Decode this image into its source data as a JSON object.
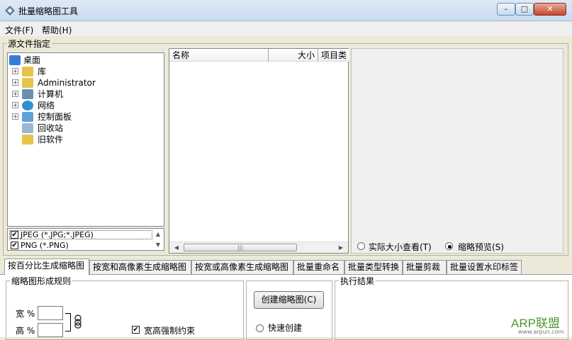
{
  "window": {
    "title": "批量缩略图工具",
    "min": "–",
    "max": "□",
    "close": "✕"
  },
  "menu": {
    "file": "文件(F)",
    "help": "帮助(H)"
  },
  "source_group": {
    "label": "源文件指定"
  },
  "tree": [
    {
      "label": "桌面",
      "icon": "desktop-icon",
      "expander": false
    },
    {
      "label": "库",
      "icon": "library-icon",
      "expander": true
    },
    {
      "label": "Administrator",
      "icon": "user-folder-icon",
      "expander": true
    },
    {
      "label": "计算机",
      "icon": "computer-icon",
      "expander": true
    },
    {
      "label": "网络",
      "icon": "network-icon",
      "expander": true
    },
    {
      "label": "控制面板",
      "icon": "control-panel-icon",
      "expander": true
    },
    {
      "label": "回收站",
      "icon": "recycle-bin-icon",
      "expander": false
    },
    {
      "label": "旧软件",
      "icon": "folder-icon",
      "expander": false
    }
  ],
  "filters": [
    {
      "label": "JPEG (*.JPG;*.JPEG)",
      "checked": true
    },
    {
      "label": "PNG (*.PNG)",
      "checked": true
    }
  ],
  "file_list": {
    "col_name": "名称",
    "col_size": "大小",
    "col_type": "项目类",
    "scroll_grip": "|||"
  },
  "preview": {
    "actual_size": "实际大小查看(T)",
    "thumb_preview": "缩略预览(S)",
    "selected": "thumb_preview"
  },
  "tabs": [
    "按百分比生成缩略图",
    "按宽和高像素生成缩略图",
    "按宽或高像素生成缩略图",
    "批量重命名",
    "批量类型转换",
    "批量剪裁",
    "批量设置水印标签"
  ],
  "active_tab": 0,
  "rules": {
    "label": "缩略图形成规则",
    "width_label": "宽 %",
    "height_label": "高 %",
    "width_value": "",
    "height_value": "",
    "force_ratio": "宽高强制约束",
    "force_ratio_checked": true
  },
  "actions": {
    "create_button": "创建缩略图(C)",
    "quick_create": "快速创建"
  },
  "results": {
    "label": "执行结果"
  },
  "watermark": {
    "brand": "ARP联盟",
    "url": "www.arpun.com"
  },
  "colors": {
    "tree_icon_blue": "#3a7bd5",
    "folder_yellow": "#e8c34a",
    "title_bg": "#c9dbef"
  }
}
